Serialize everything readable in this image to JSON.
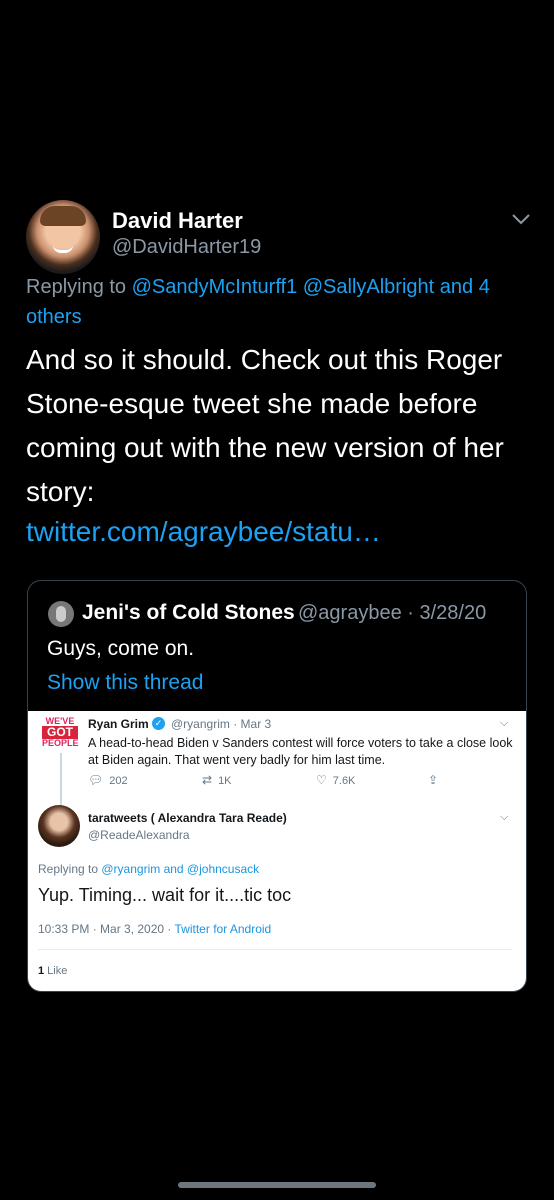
{
  "tweet": {
    "author_name": "David Harter",
    "author_handle": "@DavidHarter19",
    "reply_prefix": "Replying to ",
    "reply_mentions": "@SandyMcInturff1 @SallyAlbright and 4 others",
    "body": "And so it should.  Check out this Roger Stone-esque tweet she made before coming out with the new version of her story:",
    "link": "twitter.com/agraybee/statu…",
    "menu_icon": "chevron-down-icon"
  },
  "quoted": {
    "author_name": "Jeni's of Cold Stones",
    "author_handle_date": "@agraybee · 3/28/20",
    "text": "Guys, come on.",
    "show_thread": "Show this thread"
  },
  "screenshot": {
    "ryan": {
      "logo_line1": "WE'VE",
      "logo_line2": "GOT",
      "logo_line3": "PEOPLE",
      "name": "Ryan Grim",
      "handle_date": "@ryangrim · Mar 3",
      "text": "A head-to-head Biden v Sanders contest will force voters to take a close look at Biden again. That went very badly for him last time.",
      "replies": "202",
      "retweets": "1K",
      "likes": "7.6K"
    },
    "tara": {
      "name": "taratweets ( Alexandra Tara Reade)",
      "handle": "@ReadeAlexandra",
      "reply_prefix": "Replying to ",
      "reply_mentions": "@ryangrim and @johncusack",
      "text": "Yup. Timing... wait for it....tic toc",
      "timestamp": "10:33 PM · Mar 3, 2020 · ",
      "client": "Twitter for Android",
      "like_count": "1",
      "like_label": " Like"
    }
  }
}
